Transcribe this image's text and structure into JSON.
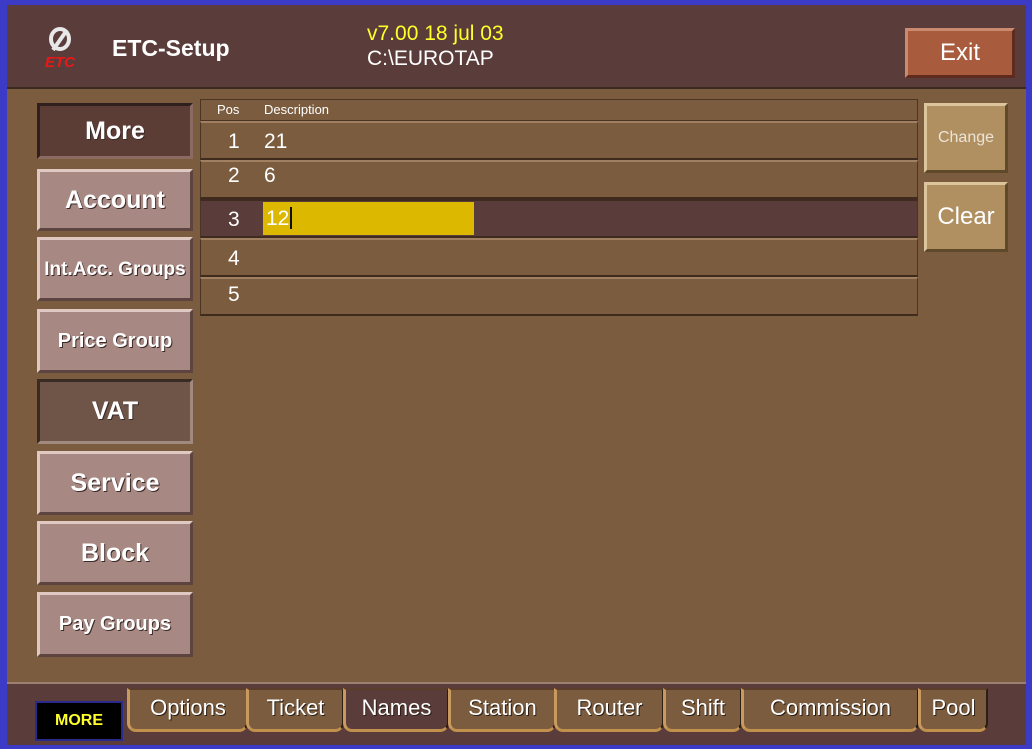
{
  "header": {
    "logo_text": "ETC",
    "title": "ETC-Setup",
    "version": "v7.00 18 jul 03",
    "path": "C:\\EUROTAP",
    "exit_label": "Exit"
  },
  "sidebar": {
    "items": [
      {
        "label": "More"
      },
      {
        "label": "Account"
      },
      {
        "label": "Int.Acc. Groups"
      },
      {
        "label": "Price Group"
      },
      {
        "label": "VAT"
      },
      {
        "label": "Service"
      },
      {
        "label": "Block"
      },
      {
        "label": "Pay Groups"
      }
    ]
  },
  "grid": {
    "columns": {
      "pos": "Pos",
      "description": "Description"
    },
    "rows": [
      {
        "pos": "1",
        "description": "21"
      },
      {
        "pos": "2",
        "description": "6"
      },
      {
        "pos": "3",
        "description": "12"
      },
      {
        "pos": "4",
        "description": ""
      },
      {
        "pos": "5",
        "description": ""
      }
    ],
    "selected_row": 3
  },
  "actions": {
    "change_label": "Change",
    "clear_label": "Clear"
  },
  "tabs": {
    "more_label": "MORE",
    "items": [
      {
        "label": "Options"
      },
      {
        "label": "Ticket"
      },
      {
        "label": "Names"
      },
      {
        "label": "Station"
      },
      {
        "label": "Router"
      },
      {
        "label": "Shift"
      },
      {
        "label": "Commission"
      },
      {
        "label": "Pool"
      }
    ],
    "active": "Names"
  },
  "colors": {
    "frame": "#3b3bc8",
    "background": "#5a3d3a",
    "panel": "#7b5c3e",
    "highlight": "#ffff2a",
    "edit_field": "#dcb800",
    "exit_button": "#a95b3d"
  }
}
